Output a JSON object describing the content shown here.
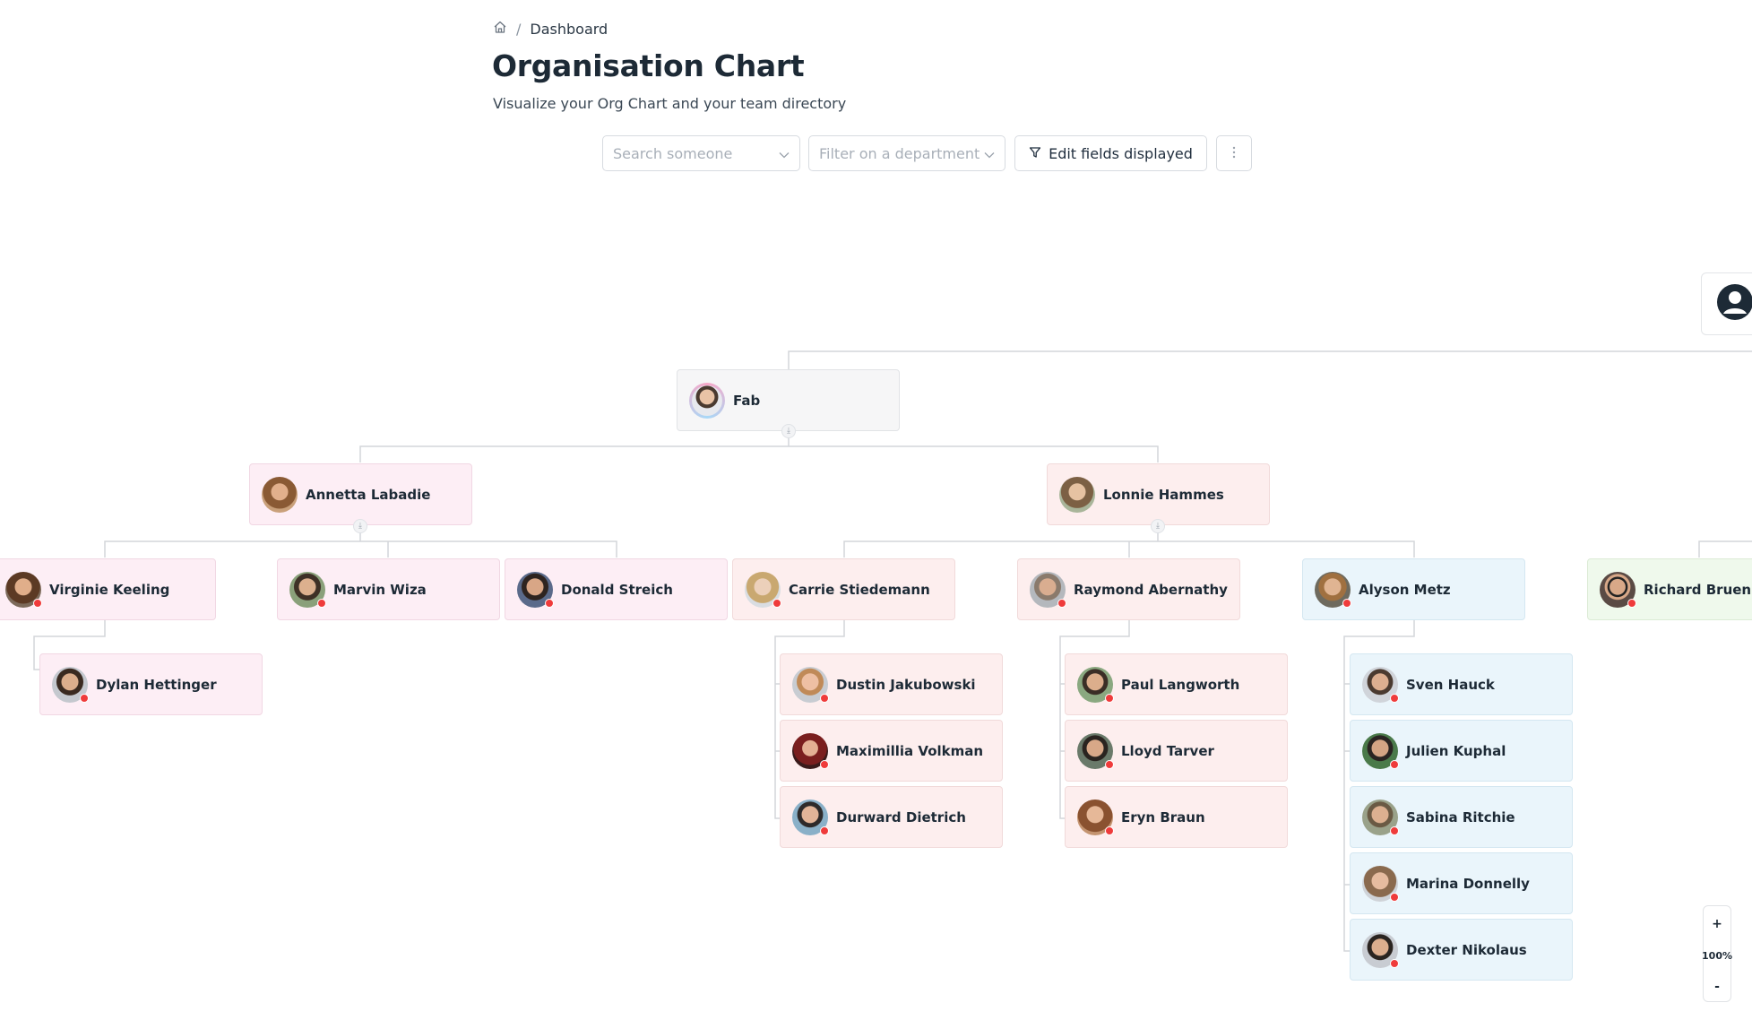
{
  "breadcrumb": {
    "home_icon": "home-icon",
    "separator": "/",
    "current": "Dashboard"
  },
  "header": {
    "title": "Organisation Chart",
    "subtitle": "Visualize your Org Chart and your team directory"
  },
  "toolbar": {
    "search_placeholder": "Search someone",
    "department_placeholder": "Filter on a department",
    "edit_fields_label": "Edit fields displayed",
    "more_icon": "vertical-dots-icon",
    "filter_icon": "filter-icon"
  },
  "colors": {
    "gray": "#f6f6f7",
    "pink": "#fdeef5",
    "peach": "#fdeeee",
    "blue": "#eaf5fb",
    "green": "#eff9ec",
    "status_dot": "#ef3b3b",
    "connector": "#d3d6da"
  },
  "org": {
    "root": {
      "name": "Fab"
    },
    "managers": [
      {
        "name": "Annetta Labadie"
      },
      {
        "name": "Lonnie Hammes"
      }
    ],
    "level2": [
      {
        "name": "Virginie Keeling"
      },
      {
        "name": "Marvin Wiza"
      },
      {
        "name": "Donald Streich"
      },
      {
        "name": "Carrie Stiedemann"
      },
      {
        "name": "Raymond Abernathy"
      },
      {
        "name": "Alyson Metz"
      },
      {
        "name": "Richard Bruen"
      }
    ],
    "level3": [
      {
        "name": "Dylan Hettinger"
      },
      {
        "name": "Dustin Jakubowski"
      },
      {
        "name": "Maximillia Volkman"
      },
      {
        "name": "Durward Dietrich"
      },
      {
        "name": "Paul Langworth"
      },
      {
        "name": "Lloyd Tarver"
      },
      {
        "name": "Eryn Braun"
      },
      {
        "name": "Sven Hauck"
      },
      {
        "name": "Julien Kuphal"
      },
      {
        "name": "Sabina Ritchie"
      },
      {
        "name": "Marina Donnelly"
      },
      {
        "name": "Dexter Nikolaus"
      }
    ]
  },
  "zoom": {
    "plus": "+",
    "level": "100%",
    "minus": "-"
  }
}
